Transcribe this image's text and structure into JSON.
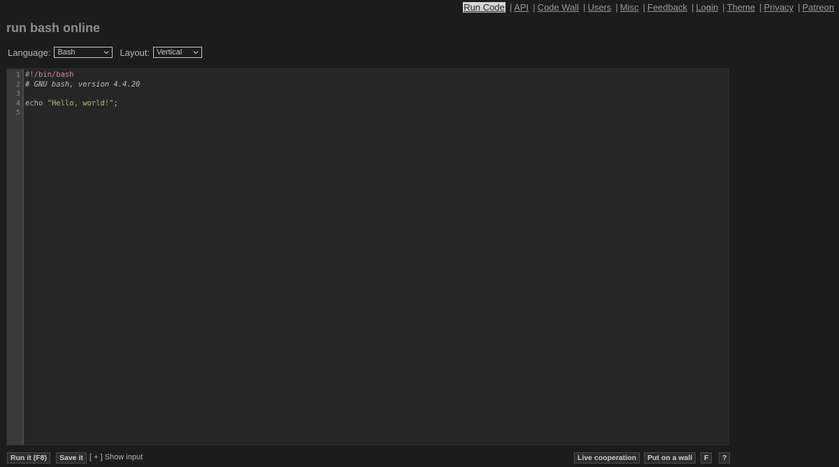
{
  "nav": {
    "items": [
      {
        "label": "Run Code",
        "active": true
      },
      {
        "label": "API"
      },
      {
        "label": "Code Wall"
      },
      {
        "label": "Users"
      },
      {
        "label": "Misc"
      },
      {
        "label": "Feedback"
      },
      {
        "label": "Login"
      },
      {
        "label": "Theme"
      },
      {
        "label": "Privacy"
      },
      {
        "label": "Patreon"
      }
    ],
    "separator": "|"
  },
  "page": {
    "title": "run bash online"
  },
  "controls": {
    "language_label": "Language:",
    "language_value": "Bash",
    "layout_label": "Layout:",
    "layout_value": "Vertical"
  },
  "editor": {
    "line_numbers": [
      "1",
      "2",
      "3",
      "4",
      "5"
    ],
    "lines": {
      "l1": "#!/bin/bash",
      "l2": "# GNU bash, version 4.4.20",
      "l3": "",
      "l4_kw": "echo",
      "l4_sp": " ",
      "l4_str": "\"Hello, world!\"",
      "l4_end": ";",
      "l5": ""
    }
  },
  "bottombar": {
    "run_label": "Run it (F8)",
    "save_label": "Save it",
    "show_input": "[ + ] Show input",
    "live_label": "Live cooperation",
    "wall_label": "Put on a wall",
    "f_label": "F",
    "help_label": "?"
  },
  "colors": {
    "background": "#1c1c1c",
    "editor_bg": "#262626",
    "gutter_bg": "#3a3a3a"
  }
}
